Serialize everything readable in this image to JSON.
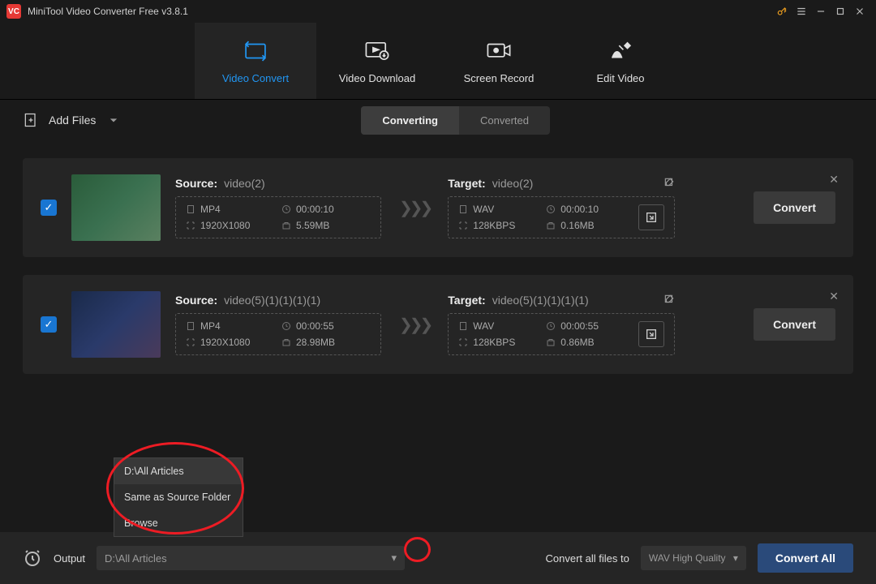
{
  "app": {
    "title": "MiniTool Video Converter Free v3.8.1"
  },
  "tabs": {
    "convert": "Video Convert",
    "download": "Video Download",
    "record": "Screen Record",
    "edit": "Edit Video"
  },
  "toolbar": {
    "add_files": "Add Files",
    "converting": "Converting",
    "converted": "Converted"
  },
  "rows": [
    {
      "source_label": "Source:",
      "source_name": "video(2)",
      "src_format": "MP4",
      "src_duration": "00:00:10",
      "src_res": "1920X1080",
      "src_size": "5.59MB",
      "target_label": "Target:",
      "target_name": "video(2)",
      "tgt_format": "WAV",
      "tgt_duration": "00:00:10",
      "tgt_bitrate": "128KBPS",
      "tgt_size": "0.16MB",
      "convert": "Convert"
    },
    {
      "source_label": "Source:",
      "source_name": "video(5)(1)(1)(1)(1)",
      "src_format": "MP4",
      "src_duration": "00:00:55",
      "src_res": "1920X1080",
      "src_size": "28.98MB",
      "target_label": "Target:",
      "target_name": "video(5)(1)(1)(1)(1)",
      "tgt_format": "WAV",
      "tgt_duration": "00:00:55",
      "tgt_bitrate": "128KBPS",
      "tgt_size": "0.86MB",
      "convert": "Convert"
    }
  ],
  "footer": {
    "output_label": "Output",
    "output_value": "D:\\All Articles",
    "convert_all_label": "Convert all files to",
    "preset": "WAV High Quality",
    "convert_all": "Convert All"
  },
  "dropdown": {
    "opt1": "D:\\All Articles",
    "opt2": "Same as Source Folder",
    "opt3": "Browse"
  }
}
